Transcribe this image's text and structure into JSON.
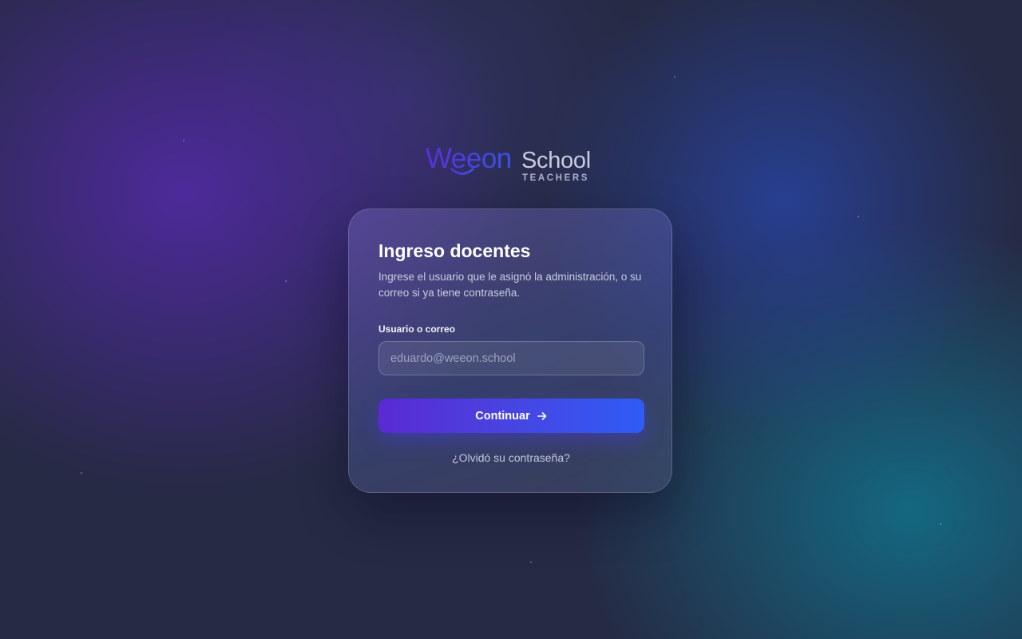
{
  "logo": {
    "brand": "Weeon",
    "product": "School",
    "tagline": "TEACHERS",
    "smile_icon": "smile-icon"
  },
  "login": {
    "title": "Ingreso docentes",
    "subtitle": "Ingrese el usuario que le asignó la administración, o su correo si ya tiene contraseña.",
    "field_label": "Usuario o correo",
    "field_placeholder": "eduardo@weeon.school",
    "field_value": "",
    "continue_label": "Continuar",
    "continue_icon": "arrow-right-icon",
    "forgot_label": "¿Olvidó su contraseña?"
  },
  "colors": {
    "background": "#262a44",
    "accent_start": "#5a2ad3",
    "accent_end": "#2f5cf6",
    "text_primary": "#ffffff",
    "text_secondary": "#c8cbe0"
  }
}
